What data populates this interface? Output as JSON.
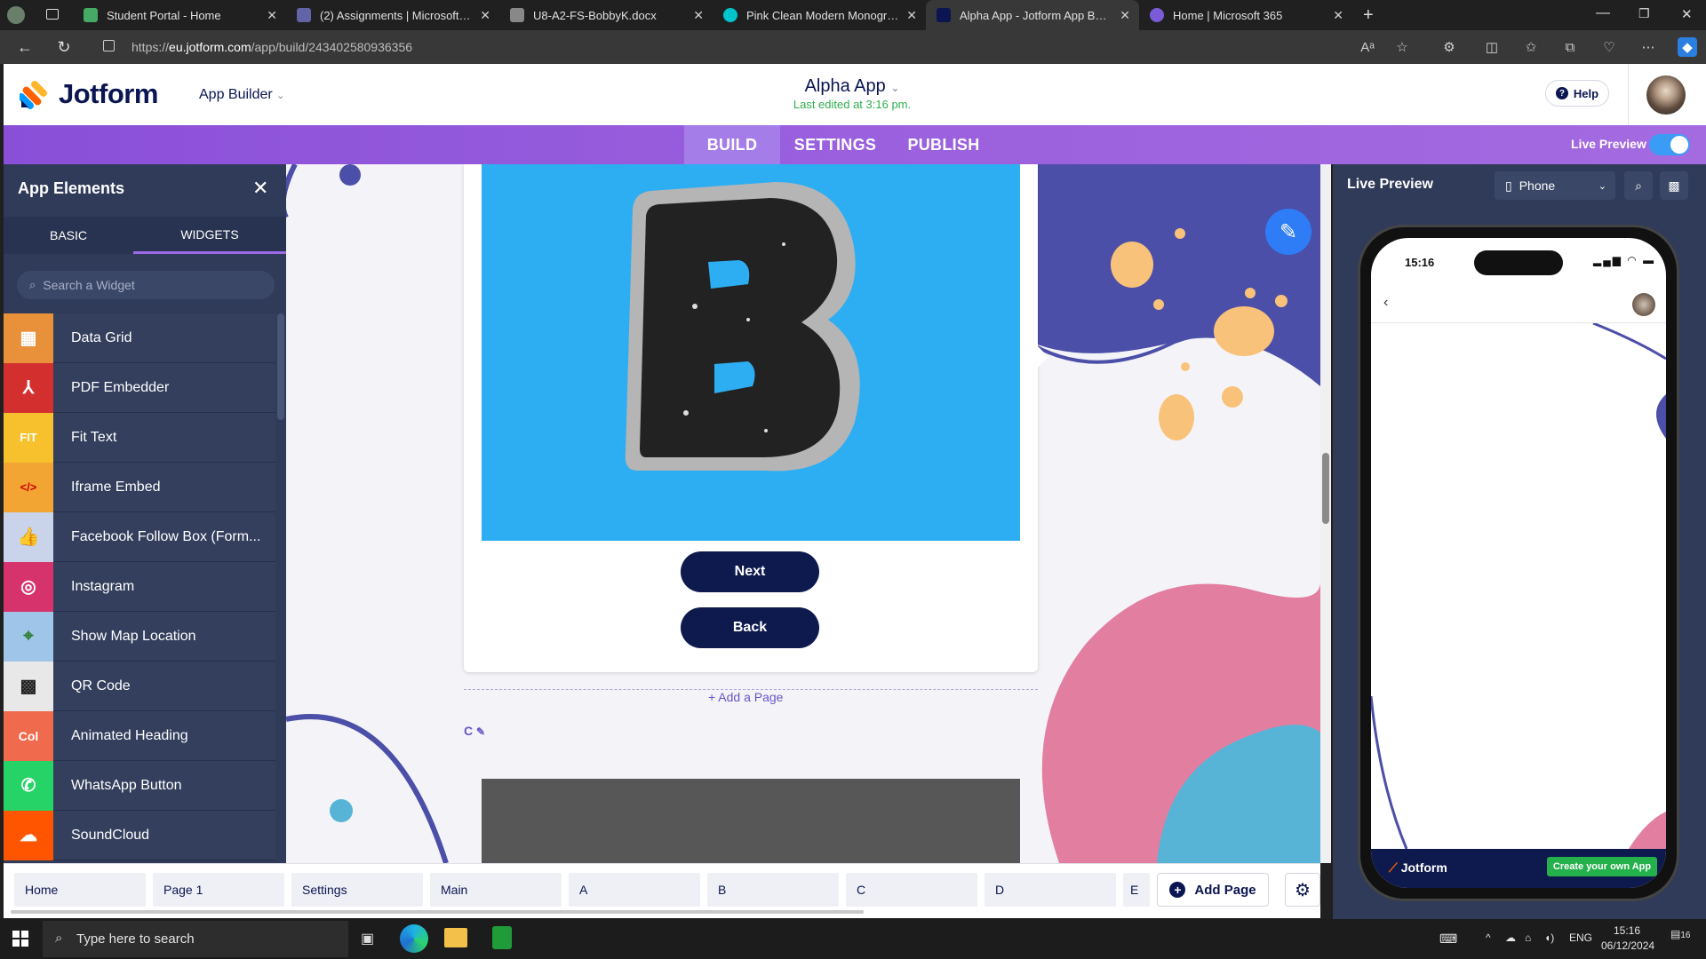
{
  "browser": {
    "tabs": [
      {
        "label": "Student Portal - Home",
        "color": "#4a6"
      },
      {
        "label": "(2) Assignments | Microsoft Teams",
        "color": "#6264a7"
      },
      {
        "label": "U8-A2-FS-BobbyK.docx",
        "color": "#888"
      },
      {
        "label": "Pink Clean Modern Monogram Ini",
        "color": "#00c4cc"
      },
      {
        "label": "Alpha App - Jotform App Builder",
        "color": "#0a1551"
      },
      {
        "label": "Home | Microsoft 365",
        "color": "#7b5cd6"
      }
    ],
    "url_prefix": "https://",
    "url_host": "eu.jotform.com",
    "url_path": "/app/build/243402580936356"
  },
  "header": {
    "brand": "Jotform",
    "app_builder": "App Builder",
    "app_title": "Alpha App",
    "last_edited": "Last edited at 3:16 pm.",
    "help": "Help"
  },
  "nav": {
    "tabs": [
      "BUILD",
      "SETTINGS",
      "PUBLISH"
    ],
    "active": "BUILD",
    "live_preview": "Live Preview"
  },
  "left_panel": {
    "title": "App Elements",
    "tabs": [
      "BASIC",
      "WIDGETS"
    ],
    "active_tab": "WIDGETS",
    "search_placeholder": "Search a Widget",
    "widgets": [
      {
        "label": "Data Grid",
        "icon": "data-grid-icon",
        "bg": "#e8913a",
        "glyph": "▦"
      },
      {
        "label": "PDF Embedder",
        "icon": "pdf-icon",
        "bg": "#d32f2f",
        "glyph": "⅄"
      },
      {
        "label": "Fit Text",
        "icon": "fit-text-icon",
        "bg": "#f6c12c",
        "glyph": "FIT"
      },
      {
        "label": "Iframe Embed",
        "icon": "code-icon",
        "bg": "#f3a533",
        "glyph": "</>"
      },
      {
        "label": "Facebook Follow Box (Form...",
        "icon": "thumbs-up-icon",
        "bg": "#c9d3ea",
        "glyph": "👍"
      },
      {
        "label": "Instagram",
        "icon": "instagram-icon",
        "bg": "#d6336c",
        "glyph": "◎"
      },
      {
        "label": "Show Map Location",
        "icon": "map-pin-icon",
        "bg": "#9fc6e8",
        "glyph": "⌖"
      },
      {
        "label": "QR Code",
        "icon": "qr-code-icon",
        "bg": "#e8e8e8",
        "glyph": "▩"
      },
      {
        "label": "Animated Heading",
        "icon": "animated-heading-icon",
        "bg": "#f06a4d",
        "glyph": "Col"
      },
      {
        "label": "WhatsApp Button",
        "icon": "whatsapp-icon",
        "bg": "#25d366",
        "glyph": "✆"
      },
      {
        "label": "SoundCloud",
        "icon": "soundcloud-icon",
        "bg": "#ff5500",
        "glyph": "☁"
      }
    ]
  },
  "canvas": {
    "next_button": "Next",
    "back_button": "Back",
    "add_page": "+ Add a Page",
    "page_label": "C"
  },
  "pages": {
    "tabs": [
      "Home",
      "Page 1",
      "Settings",
      "Main",
      "A",
      "B",
      "C",
      "D",
      "E"
    ],
    "add_page": "Add Page"
  },
  "preview": {
    "title": "Live Preview",
    "device": "Phone",
    "time": "15:16",
    "footer_brand": "Jotform",
    "footer_cta": "Create your own App"
  },
  "taskbar": {
    "search_placeholder": "Type here to search",
    "lang": "ENG",
    "time": "15:16",
    "date": "06/12/2024",
    "notif_count": "16"
  }
}
